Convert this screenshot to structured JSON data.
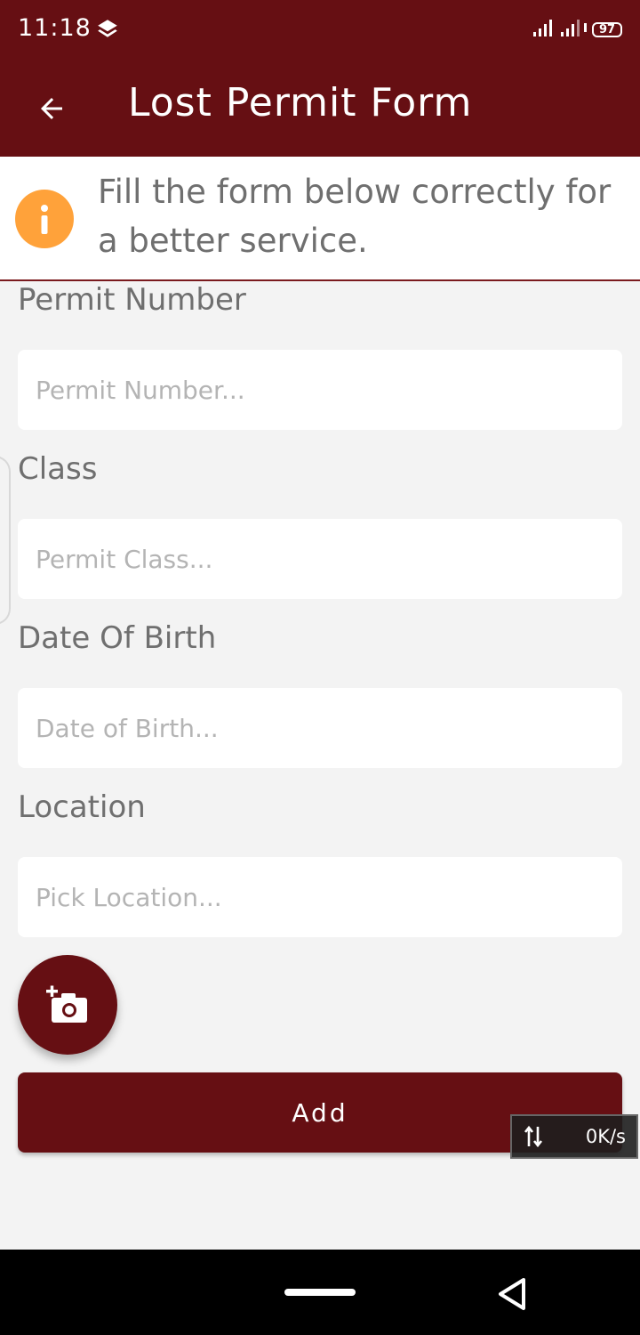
{
  "status_bar": {
    "time": "11:18",
    "battery": "97"
  },
  "app_bar": {
    "title": "Lost Permit Form"
  },
  "info": {
    "text": "Fill the form below correctly for a better service."
  },
  "form": {
    "permit_number": {
      "label": "Permit Number",
      "placeholder": "Permit Number...",
      "value": ""
    },
    "class": {
      "label": "Class",
      "placeholder": "Permit Class...",
      "value": ""
    },
    "dob": {
      "label": "Date Of Birth",
      "placeholder": "Date of Birth...",
      "value": ""
    },
    "location": {
      "label": "Location",
      "placeholder": "Pick Location...",
      "value": ""
    }
  },
  "buttons": {
    "add_label": "Add"
  },
  "overlay": {
    "net_speed": "0K/s"
  },
  "colors": {
    "primary": "#660f13",
    "info_accent": "#ffa23a",
    "background": "#f3f3f3"
  },
  "icons": [
    "layers-icon",
    "signal-icon",
    "battery-icon",
    "back-arrow-icon",
    "info-icon",
    "add-photo-icon",
    "transfer-icon",
    "home-pill-icon",
    "nav-back-icon"
  ]
}
